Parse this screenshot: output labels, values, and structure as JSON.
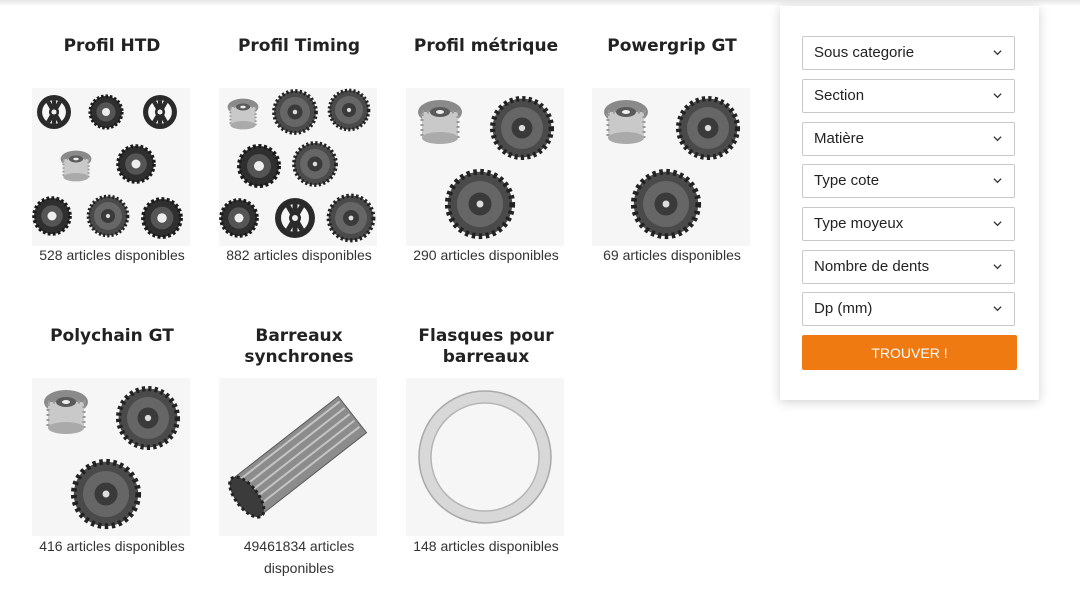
{
  "categories": [
    {
      "title": "Profil HTD",
      "count": "528 articles disponibles"
    },
    {
      "title": "Profil Timing",
      "count": "882 articles disponibles"
    },
    {
      "title": "Profil métrique",
      "count": "290 articles disponibles"
    },
    {
      "title": "Powergrip GT",
      "count": "69 articles disponibles"
    },
    {
      "title": "Polychain GT",
      "count": "416 articles disponibles"
    },
    {
      "title_line1": "Barreaux",
      "title_line2": "synchrones",
      "count_line1": "49461834 articles",
      "count_line2": "disponibles"
    },
    {
      "title_line1": "Flasques pour",
      "title_line2": "barreaux",
      "count": "148 articles disponibles"
    }
  ],
  "filters": {
    "selects": [
      {
        "label": "Sous categorie"
      },
      {
        "label": "Section"
      },
      {
        "label": "Matière"
      },
      {
        "label": "Type cote"
      },
      {
        "label": "Type moyeux"
      },
      {
        "label": "Nombre de dents"
      },
      {
        "label": "Dp (mm)"
      }
    ],
    "button_label": "TROUVER !"
  },
  "colors": {
    "accent": "#f07a12",
    "pulley_dark": "#3a3a3a",
    "pulley_light": "#b8b8b8"
  },
  "icons": {
    "select_chevron": "chevron-down-icon"
  }
}
